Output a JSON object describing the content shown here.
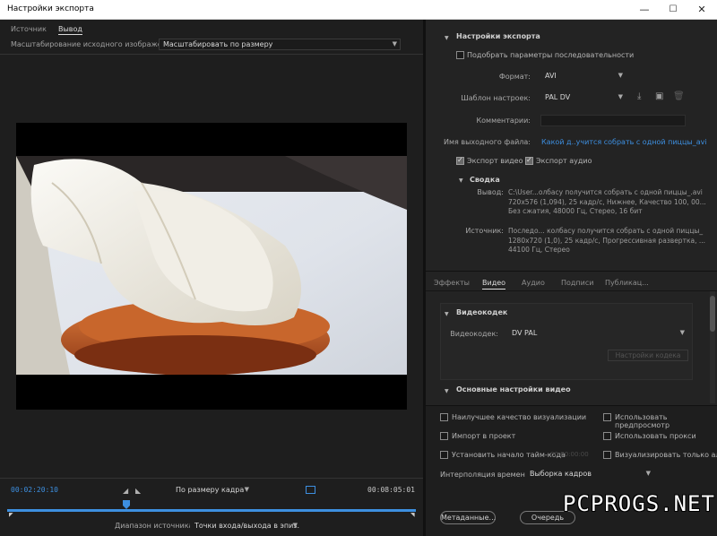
{
  "window": {
    "title": "Настройки экспорта",
    "minimize": "—",
    "maximize": "☐",
    "close": "✕"
  },
  "left": {
    "tabs": [
      {
        "label": "Источник"
      },
      {
        "label": "Вывод"
      }
    ],
    "scaling_label": "Масштабирование исходного изображения:",
    "scaling_value": "Масштабировать по размеру",
    "timeline": {
      "current_time": "00:02:20:10",
      "end_time": "00:08:05:01",
      "fit_value": "По размеру кадра",
      "source_range_label": "Диапазон источника:",
      "source_range_value": "Точки входа/выхода в эпиз..."
    }
  },
  "export": {
    "section_title": "Настройки экспорта",
    "match_sequence": "Подобрать параметры последовательности",
    "format_label": "Формат:",
    "format_value": "AVI",
    "preset_label": "Шаблон настроек:",
    "preset_value": "PAL DV",
    "comments_label": "Комментарии:",
    "comments_value": "",
    "output_name_label": "Имя выходного файла:",
    "output_name_value": "Какой д..учится собрать с одной пиццы_avi",
    "export_video": "Экспорт видео",
    "export_audio": "Экспорт аудио",
    "summary": {
      "title": "Сводка",
      "output_label": "Вывод:",
      "output_lines": [
        "C:\\User...олбасу получится собрать с одной пиццы_.avi",
        "720x576 (1,094), 25 кадр/с, Нижнее, Качество 100, 00...",
        "Без сжатия, 48000 Гц, Стерео, 16 бит"
      ],
      "source_label": "Источник:",
      "source_lines": [
        "Последо... колбасу получится собрать с одной пиццы_",
        "1280x720 (1,0), 25 кадр/с, Прогрессивная развертка, ...",
        "44100 Гц, Стерео"
      ]
    }
  },
  "right_tabs": [
    {
      "label": "Эффекты"
    },
    {
      "label": "Видео"
    },
    {
      "label": "Аудио"
    },
    {
      "label": "Подписи"
    },
    {
      "label": "Публикац..."
    }
  ],
  "video": {
    "codec_section": "Видеокодек",
    "codec_label": "Видеокодек:",
    "codec_value": "DV PAL",
    "codec_settings": "Настройки кодека",
    "basic_section": "Основные настройки видео"
  },
  "bottom": {
    "best_quality": "Наилучшее качество визуализации",
    "use_previews": "Использовать предпросмотр",
    "import_project": "Импорт в проект",
    "use_proxy": "Использовать прокси",
    "set_timecode": "Установить начало тайм-кода",
    "timecode_value": "00:00:00:00",
    "render_alpha": "Визуализировать только альфа",
    "interp_label": "Интерполяция времени:",
    "interp_value": "Выборка кадров",
    "metadata_button": "Метаданные...",
    "queue_button": "Очередь"
  },
  "watermark": "PCPROGS.NET",
  "colors": {
    "accent": "#3d8fe0",
    "panel": "#232323",
    "background": "#1e1e1e"
  },
  "icons": [
    "save-preset-icon",
    "import-preset-icon",
    "delete-preset-icon",
    "in-point-icon",
    "out-point-icon",
    "export-frame-icon",
    "playhead-icon"
  ]
}
